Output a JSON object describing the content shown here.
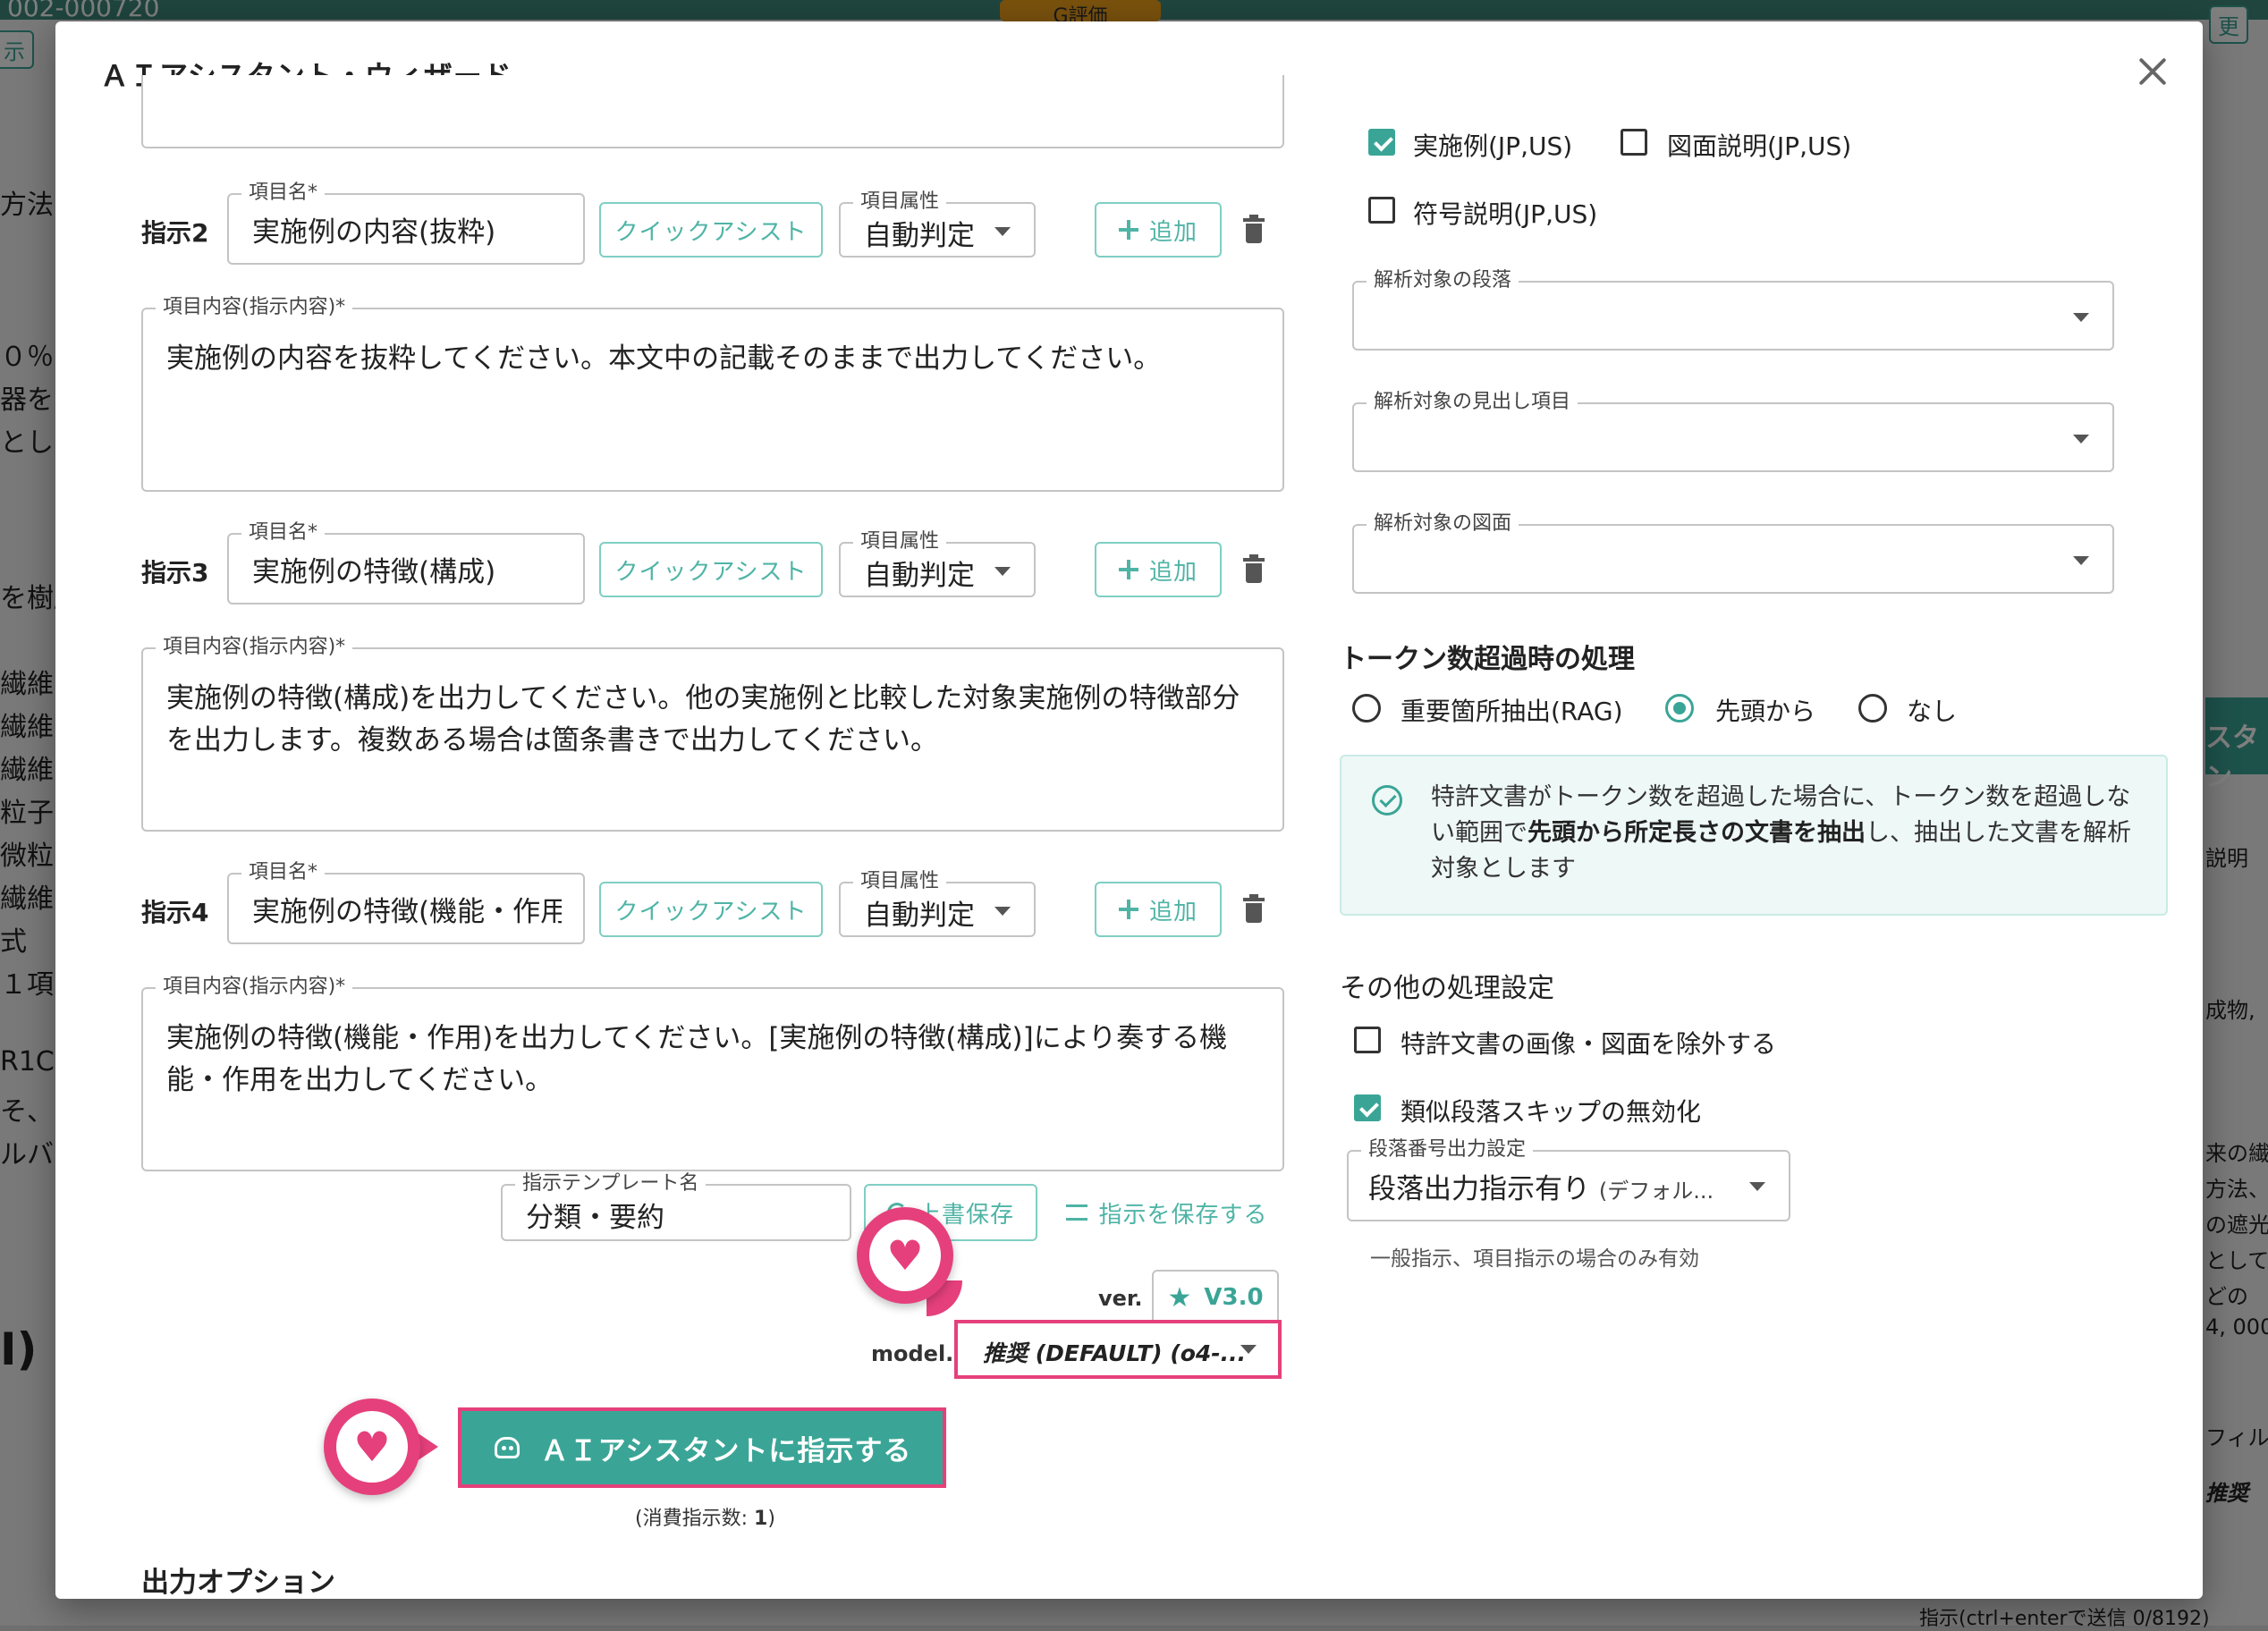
{
  "background": {
    "top_left_number": "002-000720",
    "top_center_badge": "G評価",
    "left_button": "示",
    "right_button": "更",
    "left_fragments": [
      "方法",
      "０％",
      "器を",
      "とし",
      "を樹脂",
      "繊維",
      "繊維",
      "繊維",
      "粒子が",
      "微粒",
      "繊維",
      "式",
      "１項",
      "R1C",
      "そ、ア",
      "ルバ",
      "I)"
    ],
    "right_fragments": [
      "スタン",
      "説明",
      "成物, ",
      "来の繊",
      "方法、",
      "の遮光",
      "として",
      "どの",
      "4, 000",
      "フィルム",
      "推奨"
    ],
    "bottom_hint": "指示(ctrl+enterで送信 0/8192)"
  },
  "dialog": {
    "title": "ＡＩアシスタント・ウィザード",
    "close_label": "×"
  },
  "instructions": [
    {
      "row_label": "指示2",
      "name_legend": "項目名*",
      "name_value": "実施例の内容(抜粋)",
      "quick_assist": "クイックアシスト",
      "attr_legend": "項目属性",
      "attr_value": "自動判定",
      "add_label": "追加",
      "content_legend": "項目内容(指示内容)*",
      "content_value": "実施例の内容を抜粋してください。本文中の記載そのままで出力してください。"
    },
    {
      "row_label": "指示3",
      "name_legend": "項目名*",
      "name_value": "実施例の特徴(構成)",
      "quick_assist": "クイックアシスト",
      "attr_legend": "項目属性",
      "attr_value": "自動判定",
      "add_label": "追加",
      "content_legend": "項目内容(指示内容)*",
      "content_value": "実施例の特徴(構成)を出力してください。他の実施例と比較した対象実施例の特徴部分を出力します。複数ある場合は箇条書きで出力してください。"
    },
    {
      "row_label": "指示4",
      "name_legend": "項目名*",
      "name_value": "実施例の特徴(機能・作用",
      "quick_assist": "クイックアシスト",
      "attr_legend": "項目属性",
      "attr_value": "自動判定",
      "add_label": "追加",
      "content_legend": "項目内容(指示内容)*",
      "content_value": "実施例の特徴(機能・作用)を出力してください。[実施例の特徴(構成)]により奏する機能・作用を出力してください。"
    }
  ],
  "template": {
    "legend": "指示テンプレート名",
    "value": "分類・要約",
    "overwrite_label": "上書保存",
    "save_label": "指示を保存する"
  },
  "version": {
    "label": "ver.",
    "value": "V3.0"
  },
  "model": {
    "label": "model.",
    "value": "推奨 (DEFAULT) (o4-..."
  },
  "submit": {
    "label": "ＡＩアシスタントに指示する",
    "consume_prefix": "(消費指示数: ",
    "consume_count": "1",
    "consume_suffix": ")"
  },
  "output_options_title": "出力オプション",
  "targets": {
    "checkboxes": [
      {
        "label": "実施例(JP,US)",
        "checked": true
      },
      {
        "label": "図面説明(JP,US)",
        "checked": false
      },
      {
        "label": "符号説明(JP,US)",
        "checked": false
      }
    ],
    "paragraph_legend": "解析対象の段落",
    "heading_legend": "解析対象の見出し項目",
    "figure_legend": "解析対象の図面"
  },
  "token_overflow": {
    "title": "トークン数超過時の処理",
    "options": [
      {
        "label": "重要箇所抽出(RAG)",
        "selected": false
      },
      {
        "label": "先頭から",
        "selected": true
      },
      {
        "label": "なし",
        "selected": false
      }
    ],
    "info_part1": "特許文書がトークン数を超過した場合に、トークン数を超過しない範囲で",
    "info_bold": "先頭から所定長さの文書を抽出",
    "info_part2": "し、抽出した文書を解析対象とします"
  },
  "other_settings": {
    "title": "その他の処理設定",
    "checkboxes": [
      {
        "label": "特許文書の画像・図面を除外する",
        "checked": false
      },
      {
        "label": "類似段落スキップの無効化",
        "checked": true
      }
    ],
    "paragraph_number_legend": "段落番号出力設定",
    "paragraph_number_value": "段落出力指示有り",
    "paragraph_number_suffix": "(デフォル...",
    "paragraph_number_hint": "一般指示、項目指示の場合のみ有効"
  },
  "colors": {
    "accent": "#3aa596",
    "highlight": "#e5407b",
    "info_bg": "#eef8f6"
  }
}
